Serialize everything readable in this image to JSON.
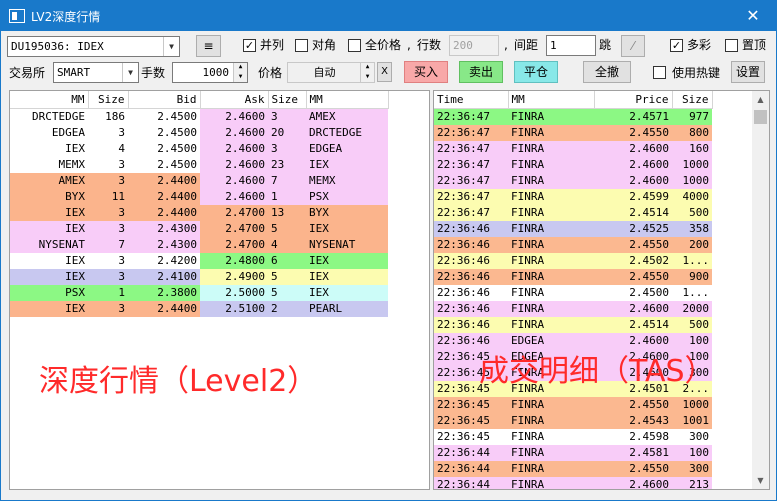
{
  "window": {
    "title": "LV2深度行情",
    "close_glyph": "✕"
  },
  "toolbar1": {
    "contract": "DU195036:  IDEX",
    "menu_glyph": "≡",
    "parallel": {
      "label": "并列",
      "checked": true
    },
    "diagonal": {
      "label": "对角",
      "checked": false
    },
    "all_prices": {
      "label": "全价格",
      "checked": false
    },
    "rows_label": "行数",
    "rows_value": "200",
    "comma1": ",",
    "comma2": ",",
    "spacing_label": "间距",
    "spacing_value": "1",
    "tick_label": "跳",
    "multicolor": {
      "label": "多彩",
      "checked": true
    },
    "pin_top": {
      "label": "置顶",
      "checked": false
    }
  },
  "toolbar2": {
    "exchange_label": "交易所",
    "exchange_value": "SMART",
    "quantity_label": "手数",
    "quantity_value": "1000",
    "price_label": "价格",
    "price_value": "自动",
    "clear_glyph": "X",
    "buy_label": "买入",
    "sell_label": "卖出",
    "close_pos_label": "平仓",
    "cancel_all_label": "全撤",
    "hotkey": {
      "label": "使用热键",
      "checked": false
    },
    "settings_label": "设置"
  },
  "colors": {
    "white": "#ffffff",
    "pink": "#f8ccf8",
    "orange": "#fbb48c",
    "green": "#8cf884",
    "lavender": "#c8c8f0",
    "yellow": "#fcfcb0",
    "cyan": "#ccfcf8",
    "salmon": "#fbb890",
    "overlay_red": "#ff2a2a"
  },
  "depth": {
    "headers": [
      "MM",
      "Size",
      "Bid",
      "Ask",
      "Size",
      "MM"
    ],
    "rows": [
      {
        "bmm": "DRCTEDGE",
        "bsize": "186",
        "bid": "2.4500",
        "ask": "2.4600",
        "asize": "3",
        "amm": "AMEX",
        "bc": "white",
        "ac": "pink"
      },
      {
        "bmm": "EDGEA",
        "bsize": "3",
        "bid": "2.4500",
        "ask": "2.4600",
        "asize": "20",
        "amm": "DRCTEDGE",
        "bc": "white",
        "ac": "pink"
      },
      {
        "bmm": "IEX",
        "bsize": "4",
        "bid": "2.4500",
        "ask": "2.4600",
        "asize": "3",
        "amm": "EDGEA",
        "bc": "white",
        "ac": "pink"
      },
      {
        "bmm": "MEMX",
        "bsize": "3",
        "bid": "2.4500",
        "ask": "2.4600",
        "asize": "23",
        "amm": "IEX",
        "bc": "white",
        "ac": "pink"
      },
      {
        "bmm": "AMEX",
        "bsize": "3",
        "bid": "2.4400",
        "ask": "2.4600",
        "asize": "7",
        "amm": "MEMX",
        "bc": "orange",
        "ac": "pink"
      },
      {
        "bmm": "BYX",
        "bsize": "11",
        "bid": "2.4400",
        "ask": "2.4600",
        "asize": "1",
        "amm": "PSX",
        "bc": "orange",
        "ac": "pink"
      },
      {
        "bmm": "IEX",
        "bsize": "3",
        "bid": "2.4400",
        "ask": "2.4700",
        "asize": "13",
        "amm": "BYX",
        "bc": "orange",
        "ac": "orange"
      },
      {
        "bmm": "IEX",
        "bsize": "3",
        "bid": "2.4300",
        "ask": "2.4700",
        "asize": "5",
        "amm": "IEX",
        "bc": "pink",
        "ac": "orange"
      },
      {
        "bmm": "NYSENAT",
        "bsize": "7",
        "bid": "2.4300",
        "ask": "2.4700",
        "asize": "4",
        "amm": "NYSENAT",
        "bc": "pink",
        "ac": "orange"
      },
      {
        "bmm": "IEX",
        "bsize": "3",
        "bid": "2.4200",
        "ask": "2.4800",
        "asize": "6",
        "amm": "IEX",
        "bc": "white",
        "ac": "green"
      },
      {
        "bmm": "IEX",
        "bsize": "3",
        "bid": "2.4100",
        "ask": "2.4900",
        "asize": "5",
        "amm": "IEX",
        "bc": "lavender",
        "ac": "yellow"
      },
      {
        "bmm": "PSX",
        "bsize": "1",
        "bid": "2.3800",
        "ask": "2.5000",
        "asize": "5",
        "amm": "IEX",
        "bc": "green",
        "ac": "cyan"
      },
      {
        "bmm": "IEX",
        "bsize": "3",
        "bid": "2.4400",
        "ask": "2.5100",
        "asize": "2",
        "amm": "PEARL",
        "bc": "orange",
        "ac": "lavender"
      }
    ]
  },
  "tas": {
    "headers": [
      "Time",
      "MM",
      "Price",
      "Size"
    ],
    "rows": [
      {
        "time": "22:36:47",
        "mm": "FINRA",
        "price": "2.4571",
        "size": "977",
        "c": "green"
      },
      {
        "time": "22:36:47",
        "mm": "FINRA",
        "price": "2.4550",
        "size": "800",
        "c": "salmon"
      },
      {
        "time": "22:36:47",
        "mm": "FINRA",
        "price": "2.4600",
        "size": "160",
        "c": "pink"
      },
      {
        "time": "22:36:47",
        "mm": "FINRA",
        "price": "2.4600",
        "size": "1000",
        "c": "pink"
      },
      {
        "time": "22:36:47",
        "mm": "FINRA",
        "price": "2.4600",
        "size": "1000",
        "c": "pink"
      },
      {
        "time": "22:36:47",
        "mm": "FINRA",
        "price": "2.4599",
        "size": "4000",
        "c": "yellow"
      },
      {
        "time": "22:36:47",
        "mm": "FINRA",
        "price": "2.4514",
        "size": "500",
        "c": "yellow"
      },
      {
        "time": "22:36:46",
        "mm": "FINRA",
        "price": "2.4525",
        "size": "358",
        "c": "lavender"
      },
      {
        "time": "22:36:46",
        "mm": "FINRA",
        "price": "2.4550",
        "size": "200",
        "c": "salmon"
      },
      {
        "time": "22:36:46",
        "mm": "FINRA",
        "price": "2.4502",
        "size": "1...",
        "c": "yellow"
      },
      {
        "time": "22:36:46",
        "mm": "FINRA",
        "price": "2.4550",
        "size": "900",
        "c": "salmon"
      },
      {
        "time": "22:36:46",
        "mm": "FINRA",
        "price": "2.4500",
        "size": "1...",
        "c": "white"
      },
      {
        "time": "22:36:46",
        "mm": "FINRA",
        "price": "2.4600",
        "size": "2000",
        "c": "pink"
      },
      {
        "time": "22:36:46",
        "mm": "FINRA",
        "price": "2.4514",
        "size": "500",
        "c": "yellow"
      },
      {
        "time": "22:36:46",
        "mm": "EDGEA",
        "price": "2.4600",
        "size": "100",
        "c": "pink"
      },
      {
        "time": "22:36:45",
        "mm": "EDGEA",
        "price": "2.4600",
        "size": "100",
        "c": "pink"
      },
      {
        "time": "22:36:45",
        "mm": "FINRA",
        "price": "2.4600",
        "size": "300",
        "c": "pink"
      },
      {
        "time": "22:36:45",
        "mm": "FINRA",
        "price": "2.4501",
        "size": "2...",
        "c": "yellow"
      },
      {
        "time": "22:36:45",
        "mm": "FINRA",
        "price": "2.4550",
        "size": "1000",
        "c": "salmon"
      },
      {
        "time": "22:36:45",
        "mm": "FINRA",
        "price": "2.4543",
        "size": "1001",
        "c": "salmon"
      },
      {
        "time": "22:36:45",
        "mm": "FINRA",
        "price": "2.4598",
        "size": "300",
        "c": "white"
      },
      {
        "time": "22:36:44",
        "mm": "FINRA",
        "price": "2.4581",
        "size": "100",
        "c": "pink"
      },
      {
        "time": "22:36:44",
        "mm": "FINRA",
        "price": "2.4550",
        "size": "300",
        "c": "salmon"
      },
      {
        "time": "22:36:44",
        "mm": "FINRA",
        "price": "2.4600",
        "size": "213",
        "c": "pink"
      }
    ]
  },
  "overlays": {
    "depth_label": "深度行情（Level2）",
    "tas_label": "成交明细（TAS）"
  }
}
